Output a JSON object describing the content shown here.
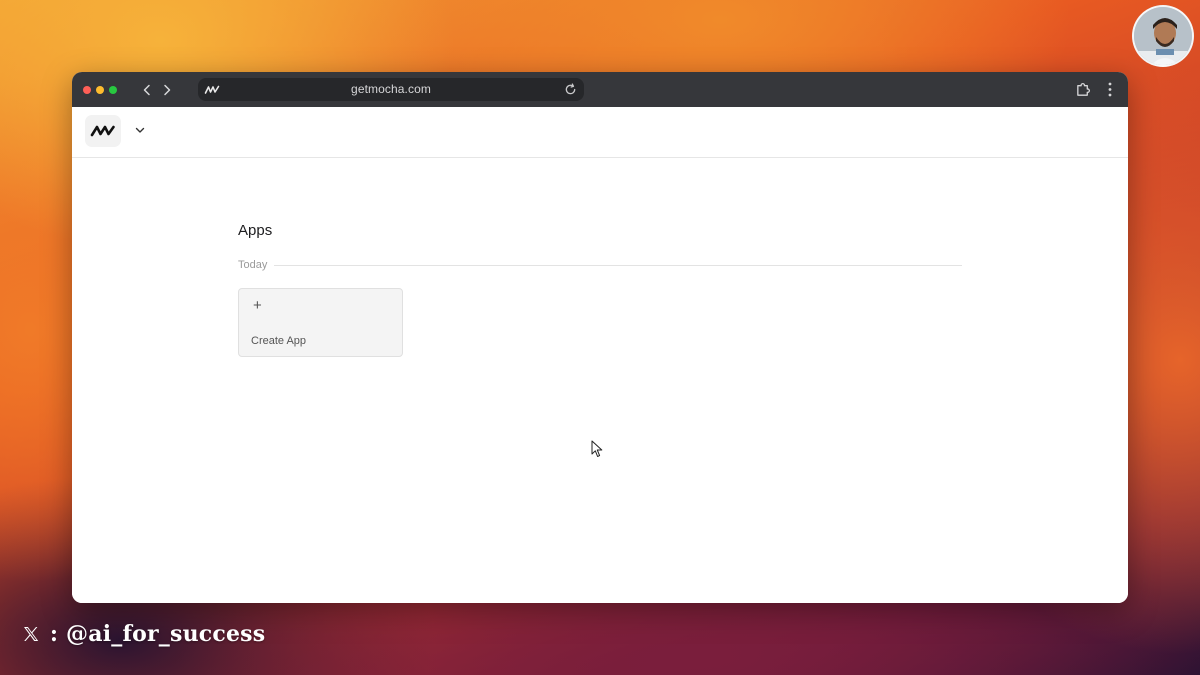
{
  "browser": {
    "url": "getmocha.com"
  },
  "apps": {
    "title": "Apps",
    "group_label": "Today",
    "create_card": {
      "icon": "+",
      "label": "Create App"
    }
  },
  "watermark": {
    "separator": " : ",
    "handle": "@ai_for_success"
  },
  "icons": {
    "back": "chevron-left-icon",
    "forward": "chevron-right-icon",
    "reload": "reload-icon",
    "extensions": "puzzle-icon",
    "menu": "kebab-menu-icon",
    "logo": "mocha-logo-icon",
    "dropdown": "chevron-down-icon",
    "social": "x-logo-icon"
  },
  "colors": {
    "titlebar": "#36373b",
    "urlbar": "#26272a",
    "card_bg": "#f4f4f4",
    "traffic_red": "#ff5f57",
    "traffic_yellow": "#febc2e",
    "traffic_green": "#28c840"
  }
}
